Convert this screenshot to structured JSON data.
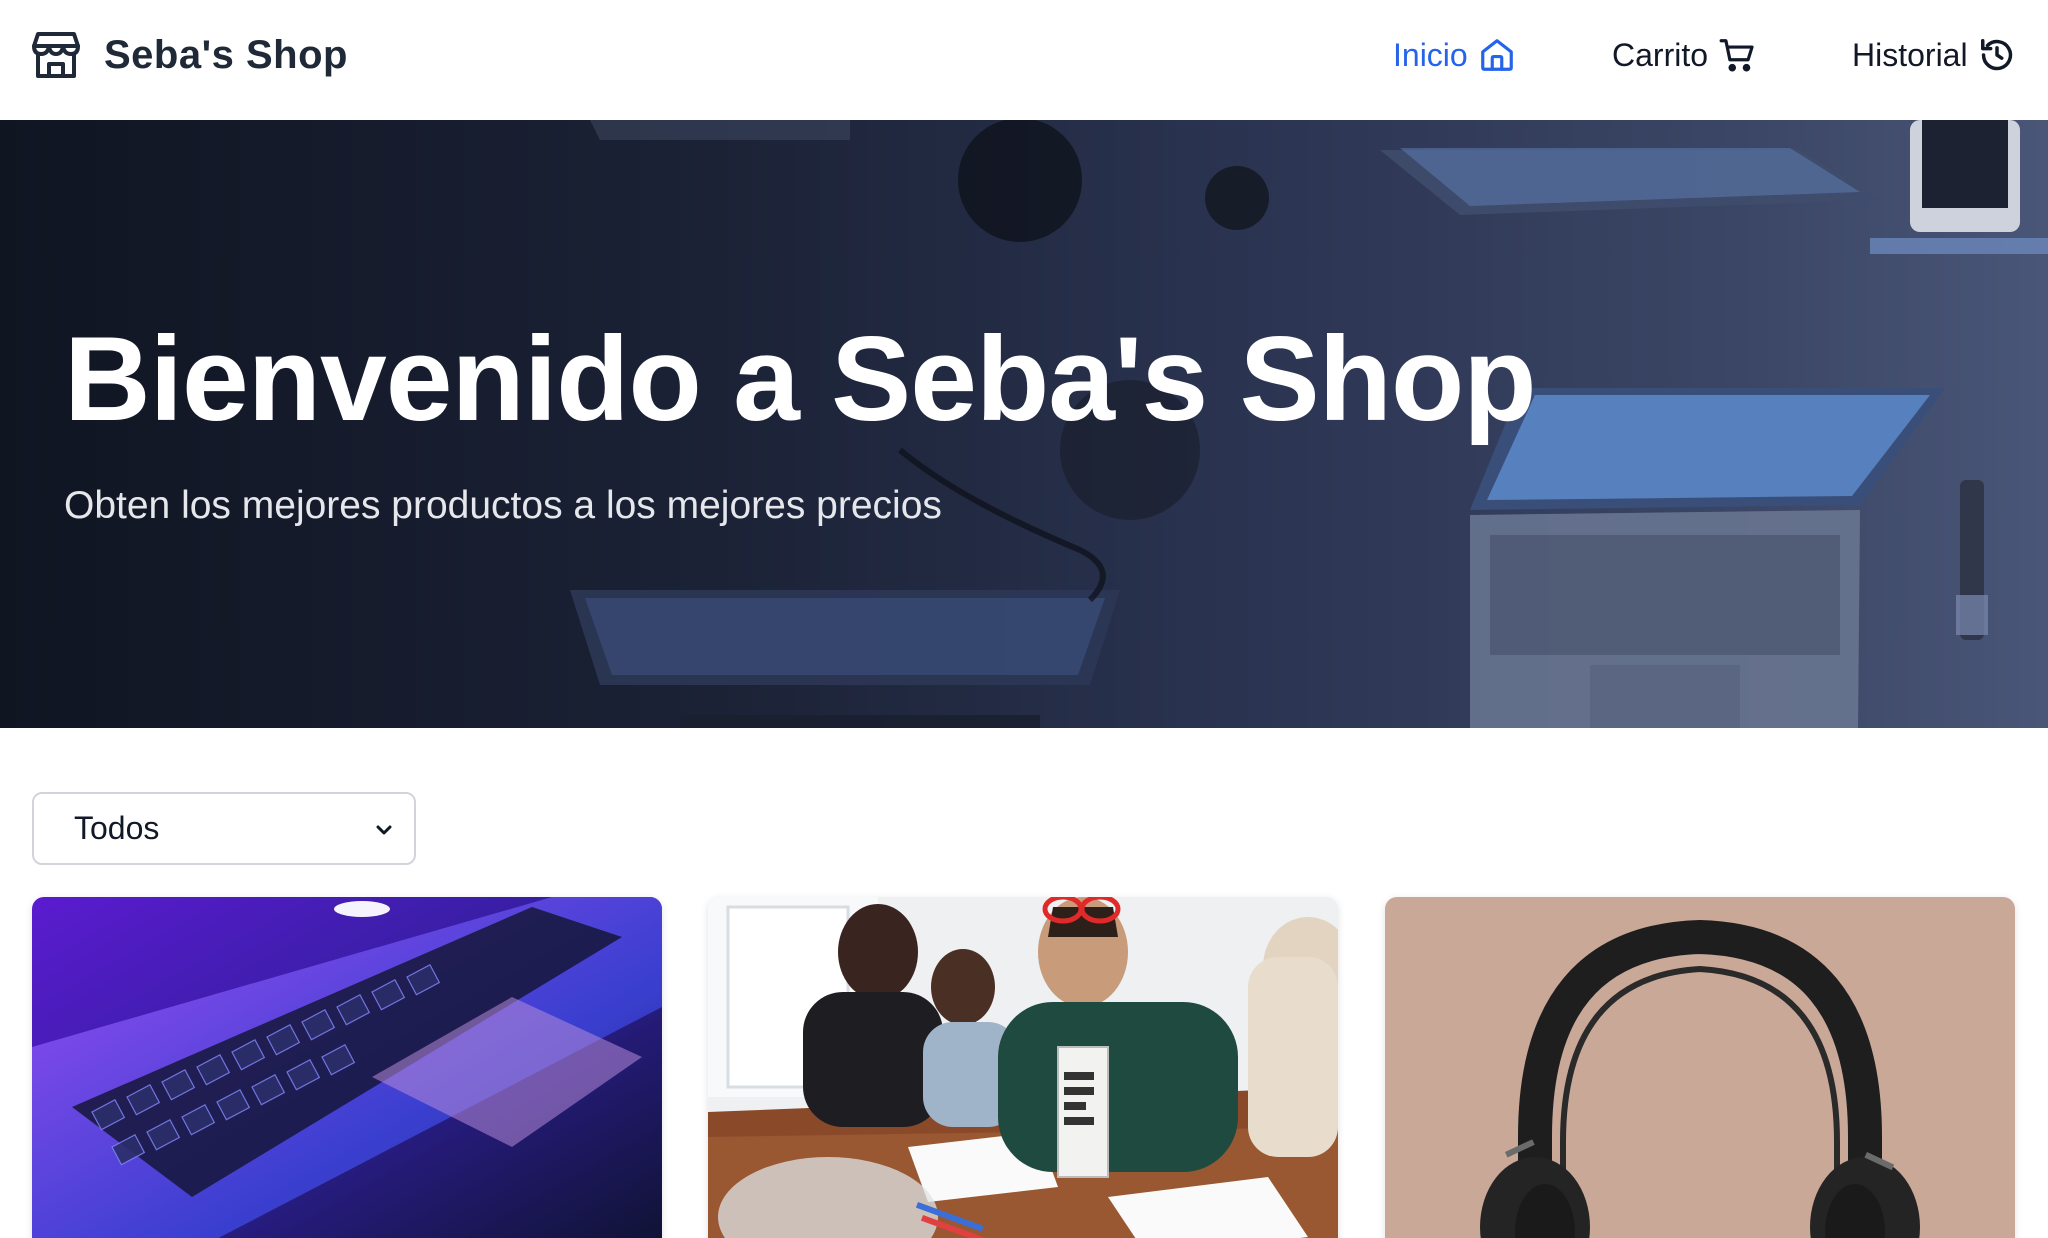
{
  "header": {
    "brand_name": "Seba's Shop",
    "brand_icon": "store-icon",
    "nav": [
      {
        "label": "Inicio",
        "icon": "home-icon",
        "active": true
      },
      {
        "label": "Carrito",
        "icon": "cart-icon",
        "active": false
      },
      {
        "label": "Historial",
        "icon": "history-icon",
        "active": false
      }
    ]
  },
  "hero": {
    "title": "Bienvenido a Seba's Shop",
    "subtitle": "Obten los mejores productos a los mejores precios"
  },
  "filter": {
    "selected": "Todos"
  },
  "products": [
    {
      "image": "laptop-keyboard-photo"
    },
    {
      "image": "family-drawing-photo"
    },
    {
      "image": "headphones-photo"
    }
  ],
  "colors": {
    "accent": "#2563eb",
    "text": "#111827",
    "hero_overlay": "#1b2236"
  }
}
